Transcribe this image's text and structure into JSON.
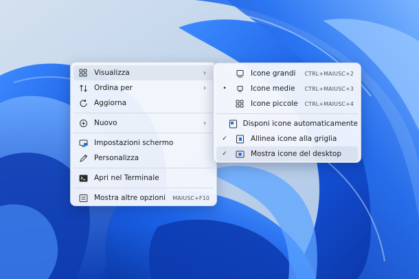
{
  "context_menu": {
    "items": [
      {
        "label": "Visualizza",
        "icon": "grid-view-icon",
        "has_submenu": true
      },
      {
        "label": "Ordina per",
        "icon": "sort-icon",
        "has_submenu": true
      },
      {
        "label": "Aggiorna",
        "icon": "refresh-icon"
      },
      {
        "label": "Nuovo",
        "icon": "add-circle-icon",
        "has_submenu": true
      },
      {
        "label": "Impostazioni schermo",
        "icon": "display-settings-icon"
      },
      {
        "label": "Personalizza",
        "icon": "pen-icon"
      },
      {
        "label": "Apri nel Terminale",
        "icon": "terminal-icon"
      },
      {
        "label": "Mostra altre opzioni",
        "icon": "more-options-icon",
        "shortcut": "MAIUSC+F10"
      }
    ]
  },
  "view_submenu": {
    "items": [
      {
        "label": "Icone grandi",
        "icon": "large-icons-icon",
        "shortcut": "CTRL+MAIUSC+2",
        "mark": ""
      },
      {
        "label": "Icone medie",
        "icon": "medium-icons-icon",
        "shortcut": "CTRL+MAIUSC+3",
        "mark": "•"
      },
      {
        "label": "Icone piccole",
        "icon": "small-icons-icon",
        "shortcut": "CTRL+MAIUSC+4",
        "mark": ""
      },
      {
        "label": "Disponi icone automaticamente",
        "icon": "auto-arrange-icon",
        "mark": ""
      },
      {
        "label": "Allinea icone alla griglia",
        "icon": "align-grid-icon",
        "mark": "✓"
      },
      {
        "label": "Mostra icone del desktop",
        "icon": "show-desktop-icons-icon",
        "mark": "✓"
      }
    ]
  },
  "colors": {
    "wallpaper_blue": "#1a5ce8",
    "menu_bg": "#f3f6fc",
    "accent": "#0067c0"
  }
}
